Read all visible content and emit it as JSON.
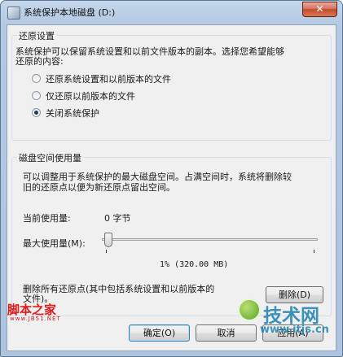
{
  "window": {
    "title": "系统保护本地磁盘 (D:)",
    "close_symbol": "✕"
  },
  "restore": {
    "legend": "还原设置",
    "description_line1": "系统保护可以保留系统设置和以前文件版本的副本。选择您希望能够",
    "description_line2": "还原的内容:",
    "options": [
      {
        "label": "还原系统设置和以前版本的文件",
        "checked": false
      },
      {
        "label": "仅还原以前版本的文件",
        "checked": false
      },
      {
        "label": "关闭系统保护",
        "checked": true
      }
    ]
  },
  "disk": {
    "legend": "磁盘空间使用量",
    "description_line1": "可以调整用于系统保护的最大磁盘空间。占满空间时，系统将删除较",
    "description_line2": "旧的还原点以便为新还原点留出空间。",
    "current_label": "当前使用量:",
    "current_value": "0 字节",
    "max_label": "最大使用量(M):",
    "max_percent": 1,
    "max_value_text": "1% (320.00 MB)",
    "delete_text_line1": "删除所有还原点(其中包括系统设置和以前版本的",
    "delete_text_line2": "文件)。",
    "delete_button": "删除(D)"
  },
  "footer": {
    "ok": "确定(O)",
    "cancel": "取消",
    "apply": "应用(A)"
  },
  "watermarks": {
    "left_brand": "脚本之家",
    "left_url": "www.JB51.NET",
    "right_brand": "技术网",
    "right_url": "www.itjs.cn"
  }
}
